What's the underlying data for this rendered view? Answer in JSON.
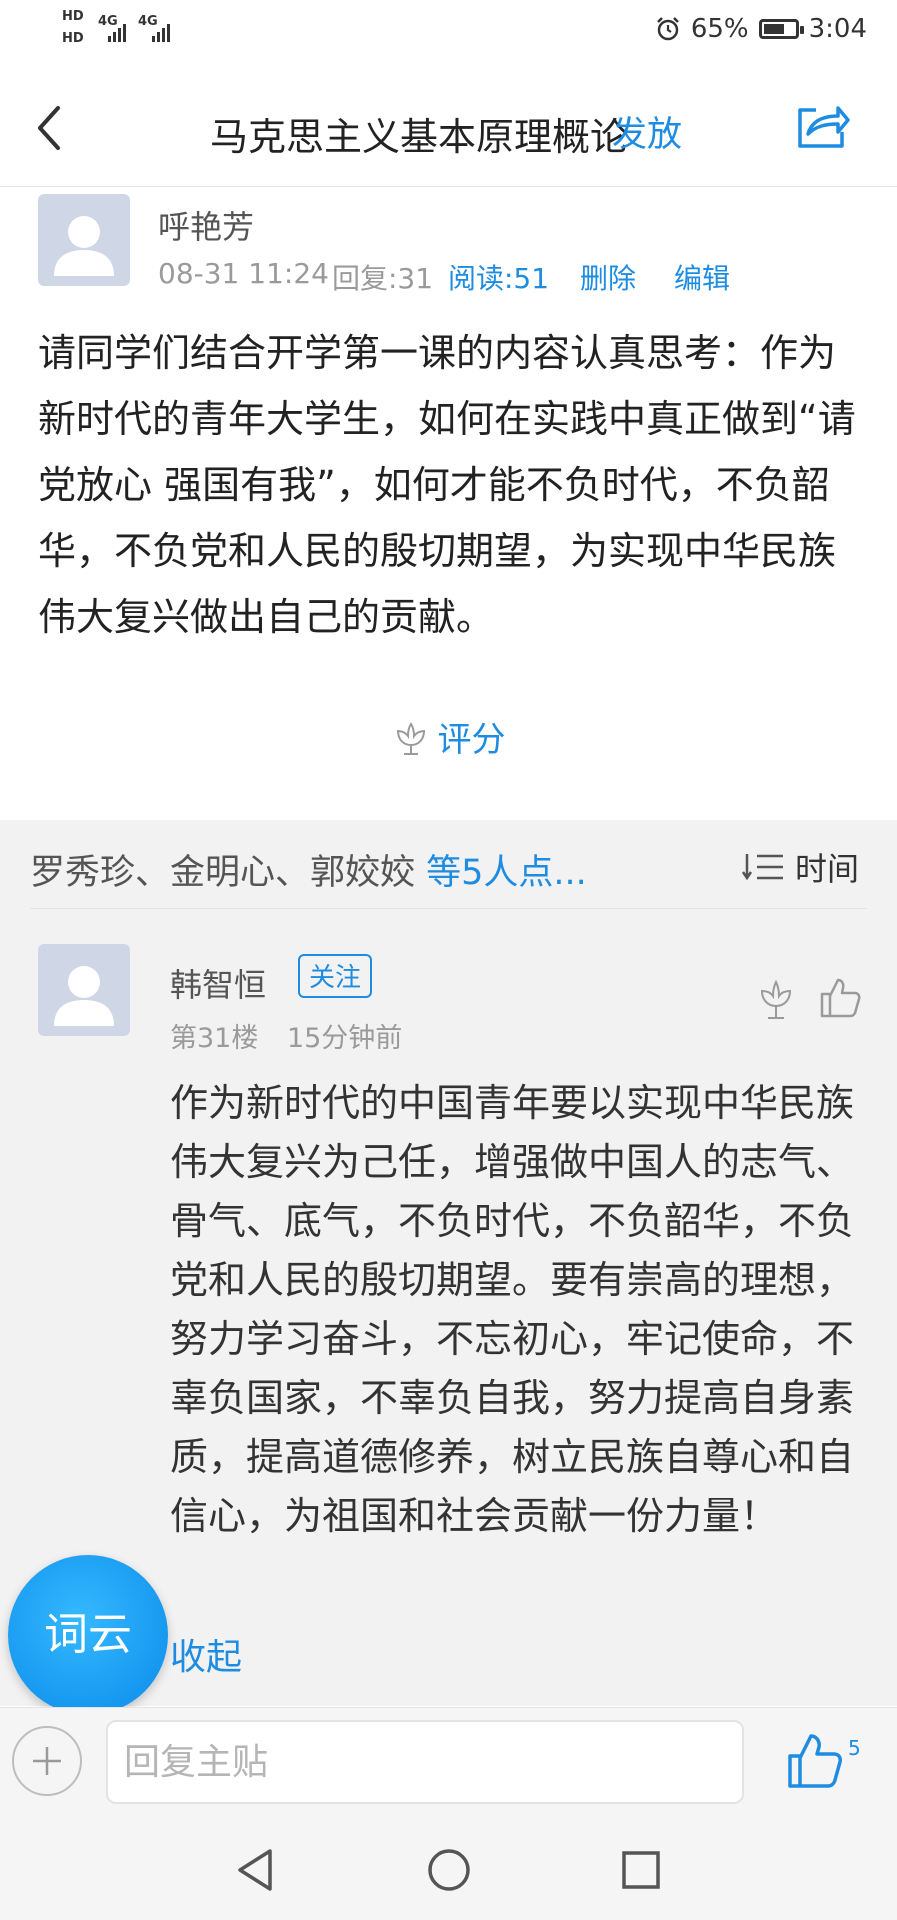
{
  "status_bar": {
    "hd1": "HD",
    "hd2": "HD",
    "net1": "4G",
    "net2": "4G",
    "battery_percent": "65%",
    "time": "3:04",
    "icons": [
      "alarm-icon",
      "signal-icon",
      "battery-icon"
    ]
  },
  "header": {
    "back_icon": "back-chevron-icon",
    "title": "马克思主义基本原理概论",
    "publish_label": "发放",
    "share_icon": "share-icon"
  },
  "post": {
    "author": "呼艳芳",
    "datetime": "08-31 11:24",
    "replies": "回复:31",
    "reads": "阅读:51",
    "delete_label": "删除",
    "edit_label": "编辑",
    "body": "请同学们结合开学第一课的内容认真思考：作为新时代的青年大学生，如何在实践中真正做到“请党放心  强国有我”，如何才能不负时代，不负韶华，不负党和人民的殷切期望，为实现中华民族伟大复兴做出自己的贡献。",
    "rate_label": "评分"
  },
  "likes": {
    "names": "罗秀珍、金明心、郭姣姣",
    "more": "等5人点...",
    "sort_label": "时间"
  },
  "reply": {
    "author": "韩智恒",
    "follow_label": "关注",
    "floor": "第31楼",
    "time_ago": "15分钟前",
    "body": "作为新时代的中国青年要以实现中华民族伟大复兴为己任，增强做中国人的志气、骨气、底气，不负时代，不负韶华，不负党和人民的殷切期望。要有崇高的理想，努力学习奋斗，不忘初心，牢记使命，不辜负国家，不辜负自我，努力提高自身素质，提高道德修养，树立民族自尊心和自信心，为祖国和社会贡献一份力量！",
    "collapse_label": "收起"
  },
  "floating": {
    "word_cloud_label": "词云"
  },
  "bottom": {
    "reply_placeholder": "回复主贴",
    "like_count": "5"
  },
  "colors": {
    "accent": "#1e8ce1",
    "background_gray": "#f2f2f2"
  }
}
